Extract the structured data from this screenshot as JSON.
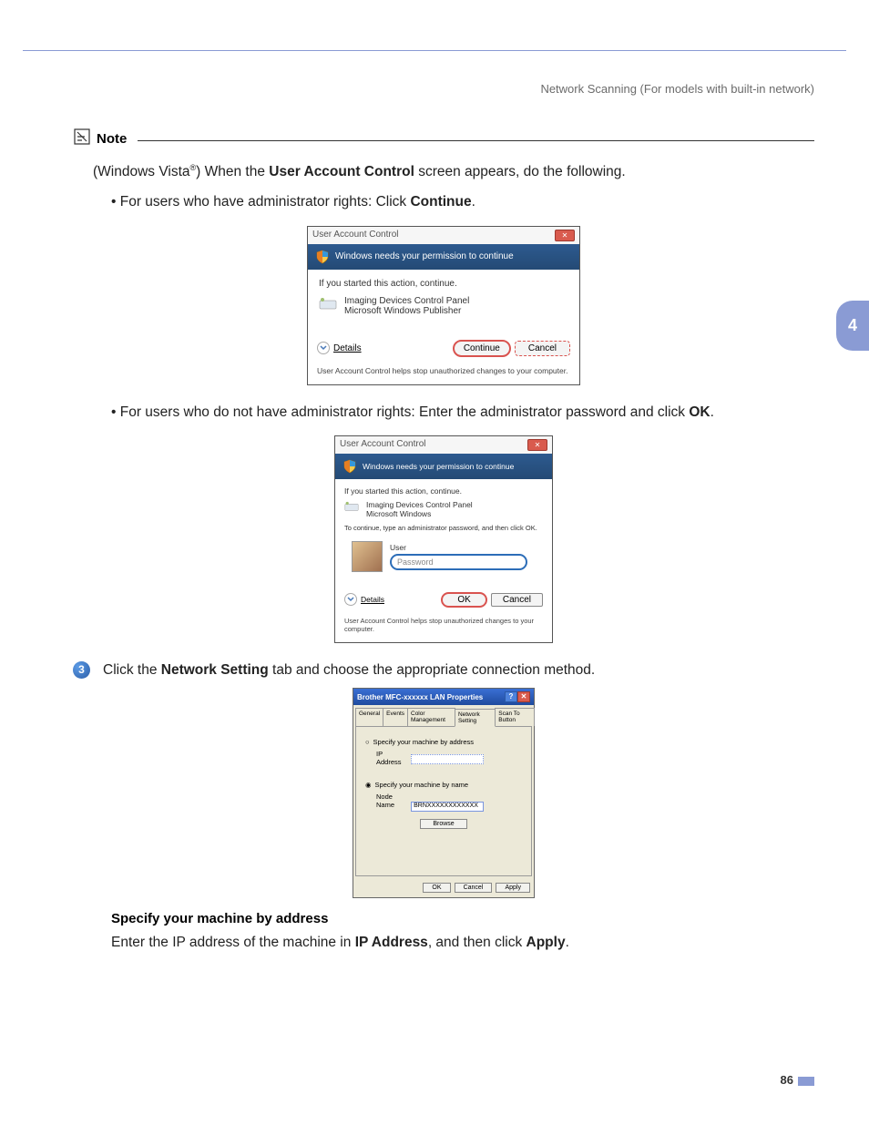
{
  "header": {
    "text": "Network Scanning (For models with built-in network)"
  },
  "sideTab": "4",
  "pageNumber": "86",
  "note": {
    "label": "Note",
    "line1_pre": "(Windows Vista",
    "line1_sup": "®",
    "line1_mid": ") When the ",
    "line1_bold": "User Account Control",
    "line1_post": " screen appears, do the following.",
    "bullet1_pre": "• For users who have administrator rights: Click ",
    "bullet1_bold": "Continue",
    "bullet1_post": ".",
    "bullet2_pre": "• For users who do not have administrator rights: Enter the administrator password and click ",
    "bullet2_bold": "OK",
    "bullet2_post": "."
  },
  "uac1": {
    "title": "User Account Control",
    "banner": "Windows needs your permission to continue",
    "intro": "If you started this action, continue.",
    "app_name": "Imaging Devices Control Panel",
    "app_publisher": "Microsoft Windows Publisher",
    "details": "Details",
    "continue": "Continue",
    "cancel": "Cancel",
    "footer": "User Account Control helps stop unauthorized changes to your computer."
  },
  "uac2": {
    "title": "User Account Control",
    "banner": "Windows needs your permission to continue",
    "intro": "If you started this action, continue.",
    "app_name": "Imaging Devices Control Panel",
    "app_publisher": "Microsoft Windows",
    "pw_instruct": "To continue, type an administrator password, and then click OK.",
    "user_label": "User",
    "pw_placeholder": "Password",
    "details": "Details",
    "ok": "OK",
    "cancel": "Cancel",
    "footer": "User Account Control helps stop unauthorized changes to your computer."
  },
  "step3": {
    "number": "3",
    "pre": "Click the ",
    "bold": "Network Setting",
    "post": " tab and choose the appropriate connection method."
  },
  "prop": {
    "title": "Brother MFC-xxxxxx  LAN Properties",
    "tabs": [
      "General",
      "Events",
      "Color Management",
      "Network Setting",
      "Scan To Button"
    ],
    "active_tab": 3,
    "radio1": "Specify your machine by address",
    "ip_label": "IP Address",
    "radio2": "Specify your machine by name",
    "node_label": "Node Name",
    "node_value": "BRNXXXXXXXXXXXX",
    "browse": "Browse",
    "ok": "OK",
    "cancel": "Cancel",
    "apply": "Apply"
  },
  "spec": {
    "heading": "Specify your machine by address",
    "line_pre": "Enter the IP address of the machine in ",
    "line_b1": "IP Address",
    "line_mid": ", and then click ",
    "line_b2": "Apply",
    "line_post": "."
  }
}
